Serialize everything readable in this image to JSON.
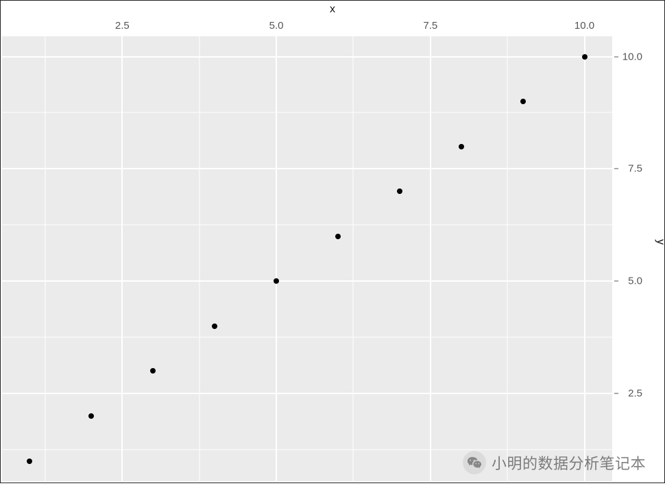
{
  "chart_data": {
    "type": "scatter",
    "x": [
      1,
      2,
      3,
      4,
      5,
      6,
      7,
      8,
      9,
      10
    ],
    "y": [
      1,
      2,
      3,
      4,
      5,
      6,
      7,
      8,
      9,
      10
    ],
    "xlabel": "x",
    "ylabel": "y",
    "x_ticks": [
      2.5,
      5.0,
      7.5,
      10.0
    ],
    "x_tick_labels": [
      "2.5",
      "5.0",
      "7.5",
      "10.0"
    ],
    "y_ticks": [
      2.5,
      5.0,
      7.5,
      10.0
    ],
    "y_tick_labels": [
      "2.5",
      "5.0",
      "7.5",
      "10.0"
    ],
    "x_minor_ticks": [
      1.25,
      3.75,
      6.25,
      8.75
    ],
    "y_minor_ticks": [
      1.25,
      3.75,
      6.25,
      8.75
    ],
    "xlim": [
      0.55,
      10.45
    ],
    "ylim": [
      0.55,
      10.45
    ],
    "grid": true,
    "x_axis_position": "top",
    "y_axis_position": "right"
  },
  "watermark": {
    "text": "小明的数据分析笔记本",
    "icon": "wechat-icon"
  }
}
